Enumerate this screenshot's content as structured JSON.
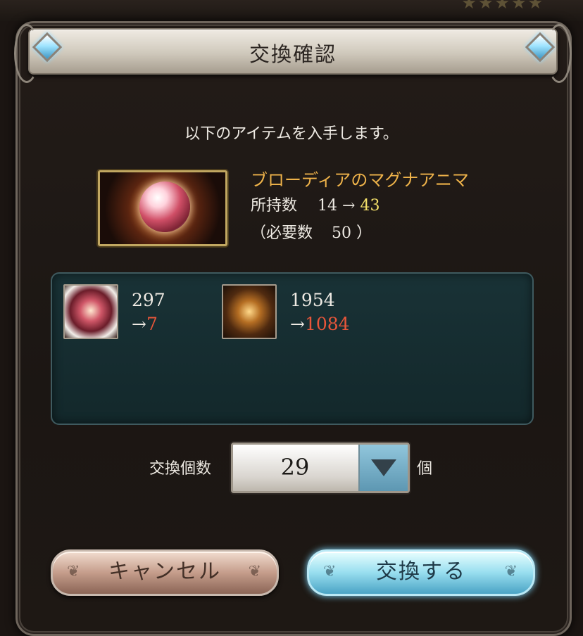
{
  "dialog": {
    "title": "交換確認",
    "info": "以下のアイテムを入手します。"
  },
  "item": {
    "name": "ブローディアのマグナアニマ",
    "owned_label": "所持数",
    "owned_before": "14",
    "arrow": "→",
    "owned_after": "43",
    "required_open": "（必要数",
    "required_value": "50",
    "required_close": "）"
  },
  "materials": [
    {
      "icon": "magna-anima-icon",
      "before": "297",
      "arrow": "→",
      "after": "7"
    },
    {
      "icon": "jewel-icon",
      "before": "1954",
      "arrow": "→",
      "after": "1084"
    }
  ],
  "quantity": {
    "label": "交換個数",
    "value": "29",
    "unit": "個"
  },
  "buttons": {
    "cancel": "キャンセル",
    "confirm": "交換する"
  },
  "colors": {
    "item_name": "#efb34a",
    "owned_after": "#f4e06a",
    "remaining": "#e8563a"
  }
}
